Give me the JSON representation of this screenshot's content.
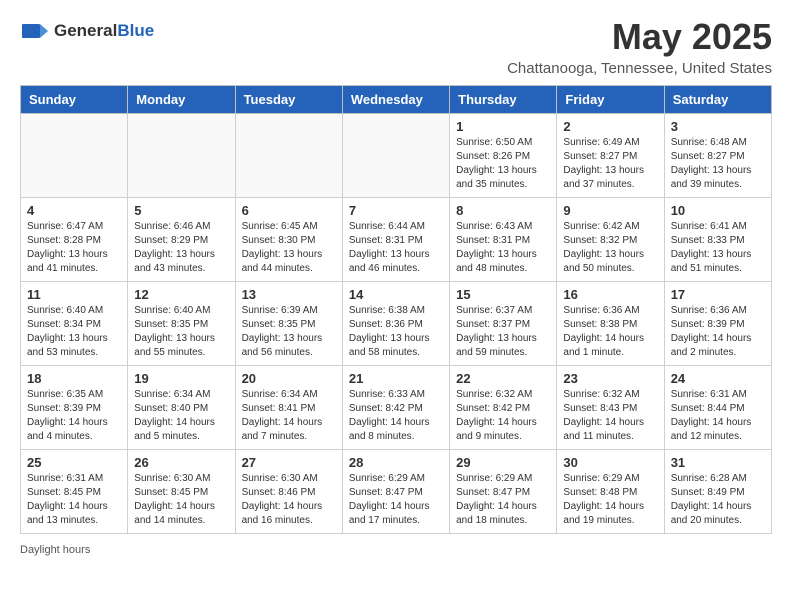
{
  "header": {
    "logo_general": "General",
    "logo_blue": "Blue",
    "month_title": "May 2025",
    "location": "Chattanooga, Tennessee, United States"
  },
  "days_of_week": [
    "Sunday",
    "Monday",
    "Tuesday",
    "Wednesday",
    "Thursday",
    "Friday",
    "Saturday"
  ],
  "weeks": [
    [
      {
        "day": "",
        "info": ""
      },
      {
        "day": "",
        "info": ""
      },
      {
        "day": "",
        "info": ""
      },
      {
        "day": "",
        "info": ""
      },
      {
        "day": "1",
        "info": "Sunrise: 6:50 AM\nSunset: 8:26 PM\nDaylight: 13 hours and 35 minutes."
      },
      {
        "day": "2",
        "info": "Sunrise: 6:49 AM\nSunset: 8:27 PM\nDaylight: 13 hours and 37 minutes."
      },
      {
        "day": "3",
        "info": "Sunrise: 6:48 AM\nSunset: 8:27 PM\nDaylight: 13 hours and 39 minutes."
      }
    ],
    [
      {
        "day": "4",
        "info": "Sunrise: 6:47 AM\nSunset: 8:28 PM\nDaylight: 13 hours and 41 minutes."
      },
      {
        "day": "5",
        "info": "Sunrise: 6:46 AM\nSunset: 8:29 PM\nDaylight: 13 hours and 43 minutes."
      },
      {
        "day": "6",
        "info": "Sunrise: 6:45 AM\nSunset: 8:30 PM\nDaylight: 13 hours and 44 minutes."
      },
      {
        "day": "7",
        "info": "Sunrise: 6:44 AM\nSunset: 8:31 PM\nDaylight: 13 hours and 46 minutes."
      },
      {
        "day": "8",
        "info": "Sunrise: 6:43 AM\nSunset: 8:31 PM\nDaylight: 13 hours and 48 minutes."
      },
      {
        "day": "9",
        "info": "Sunrise: 6:42 AM\nSunset: 8:32 PM\nDaylight: 13 hours and 50 minutes."
      },
      {
        "day": "10",
        "info": "Sunrise: 6:41 AM\nSunset: 8:33 PM\nDaylight: 13 hours and 51 minutes."
      }
    ],
    [
      {
        "day": "11",
        "info": "Sunrise: 6:40 AM\nSunset: 8:34 PM\nDaylight: 13 hours and 53 minutes."
      },
      {
        "day": "12",
        "info": "Sunrise: 6:40 AM\nSunset: 8:35 PM\nDaylight: 13 hours and 55 minutes."
      },
      {
        "day": "13",
        "info": "Sunrise: 6:39 AM\nSunset: 8:35 PM\nDaylight: 13 hours and 56 minutes."
      },
      {
        "day": "14",
        "info": "Sunrise: 6:38 AM\nSunset: 8:36 PM\nDaylight: 13 hours and 58 minutes."
      },
      {
        "day": "15",
        "info": "Sunrise: 6:37 AM\nSunset: 8:37 PM\nDaylight: 13 hours and 59 minutes."
      },
      {
        "day": "16",
        "info": "Sunrise: 6:36 AM\nSunset: 8:38 PM\nDaylight: 14 hours and 1 minute."
      },
      {
        "day": "17",
        "info": "Sunrise: 6:36 AM\nSunset: 8:39 PM\nDaylight: 14 hours and 2 minutes."
      }
    ],
    [
      {
        "day": "18",
        "info": "Sunrise: 6:35 AM\nSunset: 8:39 PM\nDaylight: 14 hours and 4 minutes."
      },
      {
        "day": "19",
        "info": "Sunrise: 6:34 AM\nSunset: 8:40 PM\nDaylight: 14 hours and 5 minutes."
      },
      {
        "day": "20",
        "info": "Sunrise: 6:34 AM\nSunset: 8:41 PM\nDaylight: 14 hours and 7 minutes."
      },
      {
        "day": "21",
        "info": "Sunrise: 6:33 AM\nSunset: 8:42 PM\nDaylight: 14 hours and 8 minutes."
      },
      {
        "day": "22",
        "info": "Sunrise: 6:32 AM\nSunset: 8:42 PM\nDaylight: 14 hours and 9 minutes."
      },
      {
        "day": "23",
        "info": "Sunrise: 6:32 AM\nSunset: 8:43 PM\nDaylight: 14 hours and 11 minutes."
      },
      {
        "day": "24",
        "info": "Sunrise: 6:31 AM\nSunset: 8:44 PM\nDaylight: 14 hours and 12 minutes."
      }
    ],
    [
      {
        "day": "25",
        "info": "Sunrise: 6:31 AM\nSunset: 8:45 PM\nDaylight: 14 hours and 13 minutes."
      },
      {
        "day": "26",
        "info": "Sunrise: 6:30 AM\nSunset: 8:45 PM\nDaylight: 14 hours and 14 minutes."
      },
      {
        "day": "27",
        "info": "Sunrise: 6:30 AM\nSunset: 8:46 PM\nDaylight: 14 hours and 16 minutes."
      },
      {
        "day": "28",
        "info": "Sunrise: 6:29 AM\nSunset: 8:47 PM\nDaylight: 14 hours and 17 minutes."
      },
      {
        "day": "29",
        "info": "Sunrise: 6:29 AM\nSunset: 8:47 PM\nDaylight: 14 hours and 18 minutes."
      },
      {
        "day": "30",
        "info": "Sunrise: 6:29 AM\nSunset: 8:48 PM\nDaylight: 14 hours and 19 minutes."
      },
      {
        "day": "31",
        "info": "Sunrise: 6:28 AM\nSunset: 8:49 PM\nDaylight: 14 hours and 20 minutes."
      }
    ]
  ],
  "footer": {
    "daylight_hours_label": "Daylight hours"
  }
}
